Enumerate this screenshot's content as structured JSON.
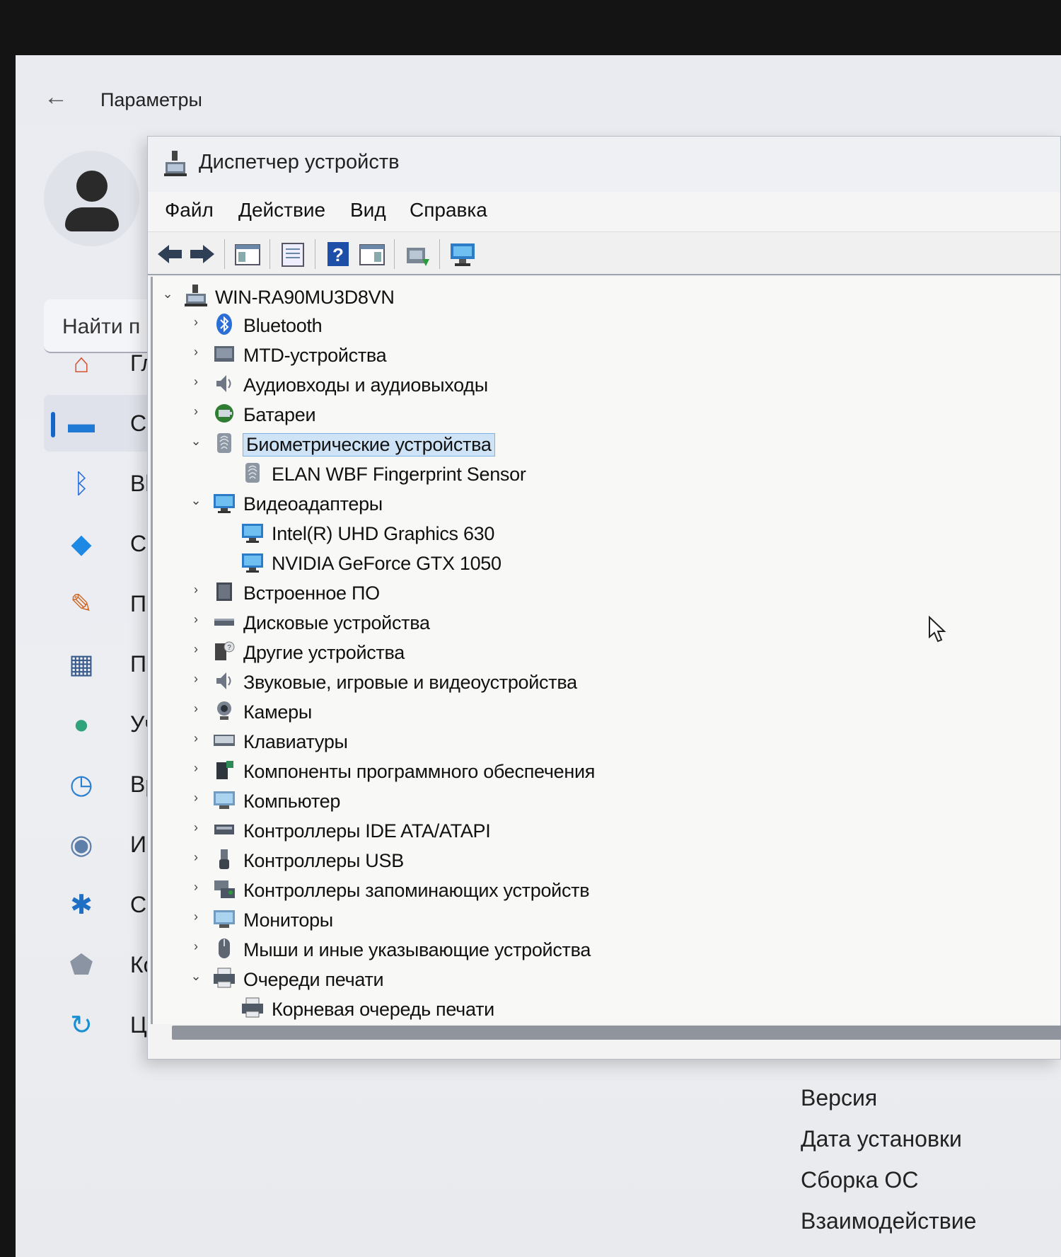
{
  "settings": {
    "back_label": "←",
    "title": "Параметры",
    "search_placeholder": "Найти п",
    "nav": [
      {
        "label": "Гла",
        "icon": "home-icon"
      },
      {
        "label": "Си",
        "icon": "system-icon"
      },
      {
        "label": "Blu",
        "icon": "bluetooth-icon"
      },
      {
        "label": "Сет",
        "icon": "network-icon"
      },
      {
        "label": "Пе",
        "icon": "personalization-icon"
      },
      {
        "label": "Пр",
        "icon": "apps-icon"
      },
      {
        "label": "Уче",
        "icon": "accounts-icon"
      },
      {
        "label": "Вр",
        "icon": "time-icon"
      },
      {
        "label": "Игр",
        "icon": "gaming-icon"
      },
      {
        "label": "Сп",
        "icon": "accessibility-icon"
      },
      {
        "label": "Конфиденциальность и защита",
        "icon": "shield-icon"
      },
      {
        "label": "Центр обновления Windows",
        "icon": "update-icon"
      }
    ],
    "sys_info": [
      "Версия",
      "Дата установки",
      "Сборка ОС",
      "Взаимодействие"
    ]
  },
  "device_manager": {
    "title": "Диспетчер устройств",
    "menu": [
      "Файл",
      "Действие",
      "Вид",
      "Справка"
    ],
    "toolbar": [
      "back",
      "forward",
      "properties-view",
      "properties",
      "help",
      "properties-pane",
      "update-driver",
      "scan-hardware"
    ],
    "root": "WIN-RA90MU3D8VN",
    "tree": [
      {
        "label": "Bluetooth",
        "level": 1,
        "expander": "›",
        "icon": "bluetooth"
      },
      {
        "label": "MTD-устройства",
        "level": 1,
        "expander": "›",
        "icon": "drive"
      },
      {
        "label": "Аудиовходы и аудиовыходы",
        "level": 1,
        "expander": "›",
        "icon": "speaker"
      },
      {
        "label": "Батареи",
        "level": 1,
        "expander": "›",
        "icon": "battery"
      },
      {
        "label": "Биометрические устройства",
        "level": 1,
        "expander": "⌄",
        "icon": "fingerprint",
        "selected": true
      },
      {
        "label": "ELAN WBF Fingerprint Sensor",
        "level": 2,
        "expander": "",
        "icon": "fingerprint"
      },
      {
        "label": "Видеоадаптеры",
        "level": 1,
        "expander": "⌄",
        "icon": "display"
      },
      {
        "label": "Intel(R) UHD Graphics 630",
        "level": 2,
        "expander": "",
        "icon": "display"
      },
      {
        "label": "NVIDIA GeForce GTX 1050",
        "level": 2,
        "expander": "",
        "icon": "display"
      },
      {
        "label": "Встроенное ПО",
        "level": 1,
        "expander": "›",
        "icon": "chip"
      },
      {
        "label": "Дисковые устройства",
        "level": 1,
        "expander": "›",
        "icon": "disk"
      },
      {
        "label": "Другие устройства",
        "level": 1,
        "expander": "›",
        "icon": "unknown"
      },
      {
        "label": "Звуковые, игровые и видеоустройства",
        "level": 1,
        "expander": "›",
        "icon": "speaker"
      },
      {
        "label": "Камеры",
        "level": 1,
        "expander": "›",
        "icon": "camera"
      },
      {
        "label": "Клавиатуры",
        "level": 1,
        "expander": "›",
        "icon": "keyboard"
      },
      {
        "label": "Компоненты программного обеспечения",
        "level": 1,
        "expander": "›",
        "icon": "software"
      },
      {
        "label": "Компьютер",
        "level": 1,
        "expander": "›",
        "icon": "monitor"
      },
      {
        "label": "Контроллеры IDE ATA/ATAPI",
        "level": 1,
        "expander": "›",
        "icon": "ide"
      },
      {
        "label": "Контроллеры USB",
        "level": 1,
        "expander": "›",
        "icon": "usb"
      },
      {
        "label": "Контроллеры запоминающих устройств",
        "level": 1,
        "expander": "›",
        "icon": "storage"
      },
      {
        "label": "Мониторы",
        "level": 1,
        "expander": "›",
        "icon": "monitor"
      },
      {
        "label": "Мыши и иные указывающие устройства",
        "level": 1,
        "expander": "›",
        "icon": "mouse"
      },
      {
        "label": "Очереди печати",
        "level": 1,
        "expander": "⌄",
        "icon": "printer"
      },
      {
        "label": "Корневая очередь печати",
        "level": 2,
        "expander": "",
        "icon": "printer"
      }
    ]
  }
}
